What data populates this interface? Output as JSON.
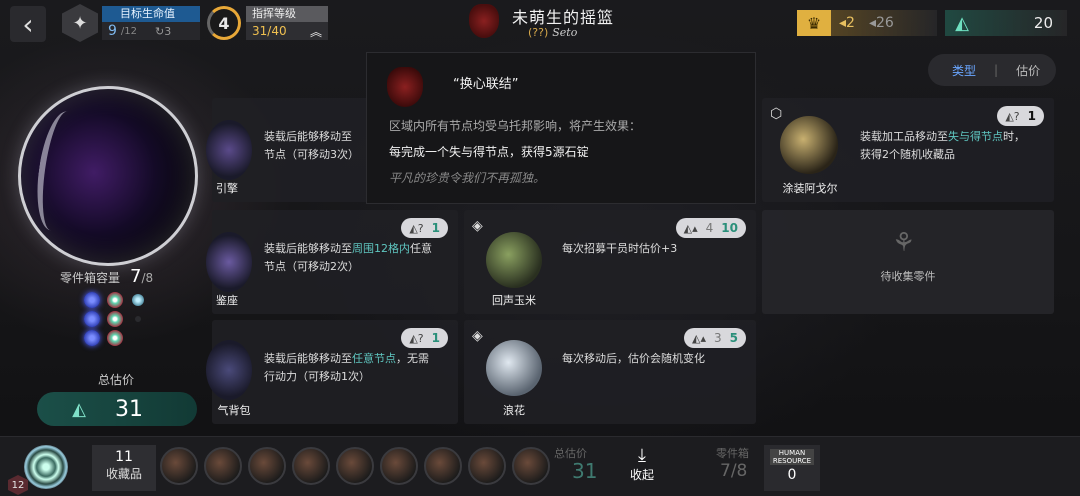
{
  "header": {
    "target": {
      "title": "目标生命值",
      "current": "9",
      "max": "/12",
      "reset": "3"
    },
    "command": {
      "level": "4",
      "title": "指挥等级",
      "value": "31/40"
    },
    "stage": {
      "title": "未萌生的摇篮",
      "sub": "(??)",
      "script": "Seto"
    },
    "gold": {
      "value1": "2",
      "value2": "26"
    },
    "teal": {
      "value": "20"
    }
  },
  "left_panel": {
    "capacity_label": "零件箱容量",
    "capacity": "7",
    "capacity_max": "/8",
    "total_label": "总估价",
    "total_value": "31"
  },
  "sort": {
    "type": "类型",
    "value": "估价"
  },
  "tooltip": {
    "title": "“换心联结”",
    "line1": "区域内所有节点均受乌托邦影响，将产生效果：",
    "line2": "每完成一个失与得节点，获得5源石锭",
    "flavor": "平凡的珍贵令我们不再孤独。"
  },
  "cards": [
    {
      "name": "引擎",
      "badge_new": "",
      "badge_old": "",
      "desc1": "装载后能够移动至",
      "desc1b": "",
      "desc2": "节点（可移动3次）"
    },
    {
      "name": "鉴座",
      "badge_new": "1",
      "badge_old": "",
      "desc1": "装载后能够移动至",
      "desc1b": "周围12格内",
      "desc1c": "任意",
      "desc2": "节点（可移动2次）"
    },
    {
      "name": "气背包",
      "badge_new": "1",
      "badge_old": "",
      "desc1": "装载后能够移动至",
      "desc1b": "任意节点",
      "desc1c": "，无需",
      "desc2": "行动力（可移动1次）"
    },
    {
      "name": "涂装阿戈尔",
      "badge_new": "1",
      "badge_old": "",
      "desc1": "装载加工品移动至",
      "desc1b": "失与得节点",
      "desc1c": "时，",
      "desc2": "获得2个随机收藏品"
    },
    {
      "name": "回声玉米",
      "badge_new": "10",
      "badge_old": "4",
      "desc1": "每次招募干员时估价+3",
      "desc2": ""
    },
    {
      "name": "浪花",
      "badge_new": "5",
      "badge_old": "3",
      "desc1": "每次移动后，估价会随机变化",
      "desc2": ""
    },
    {
      "name": "待收集零件"
    }
  ],
  "bottom": {
    "level": "12",
    "collection_count": "11",
    "collection_label": "收藏品",
    "total_label": "总估价",
    "total_value": "31",
    "collapse_label": "收起",
    "parts_label": "零件箱",
    "parts_value": "7/8",
    "human_label": "HUMAN RESOURCE",
    "human_value": "0"
  }
}
